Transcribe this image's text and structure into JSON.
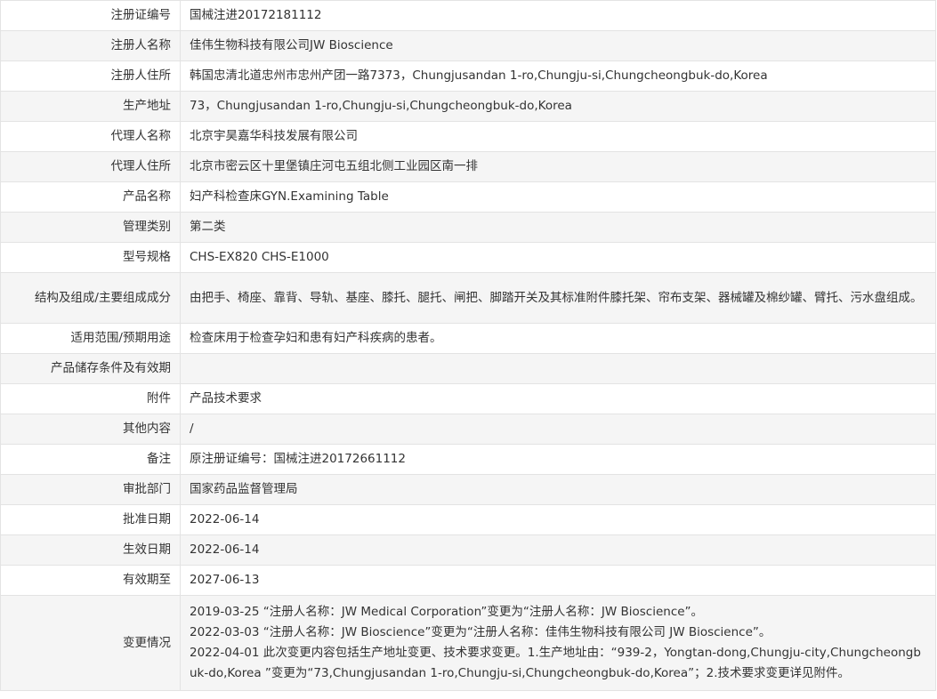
{
  "rows": [
    {
      "label": "注册证编号",
      "value": "国械注进20172181112"
    },
    {
      "label": "注册人名称",
      "value": "佳伟生物科技有限公司JW Bioscience"
    },
    {
      "label": "注册人住所",
      "value": "韩国忠清北道忠州市忠州产团一路7373，Chungjusandan 1-ro,Chungju-si,Chungcheongbuk-do,Korea"
    },
    {
      "label": "生产地址",
      "value": "73，Chungjusandan 1-ro,Chungju-si,Chungcheongbuk-do,Korea"
    },
    {
      "label": "代理人名称",
      "value": "北京宇昊嘉华科技发展有限公司"
    },
    {
      "label": "代理人住所",
      "value": "北京市密云区十里堡镇庄河屯五组北侧工业园区南一排"
    },
    {
      "label": "产品名称",
      "value": "妇产科检查床GYN.Examining Table"
    },
    {
      "label": "管理类别",
      "value": "第二类"
    },
    {
      "label": "型号规格",
      "value": "CHS-EX820 CHS-E1000"
    },
    {
      "label": "结构及组成/主要组成成分",
      "value": "由把手、椅座、靠背、导轨、基座、膝托、腿托、闸把、脚踏开关及其标准附件膝托架、帘布支架、器械罐及棉纱罐、臂托、污水盘组成。"
    },
    {
      "label": "适用范围/预期用途",
      "value": "检查床用于检查孕妇和患有妇产科疾病的患者。"
    },
    {
      "label": "产品储存条件及有效期",
      "value": ""
    },
    {
      "label": "附件",
      "value": "产品技术要求"
    },
    {
      "label": "其他内容",
      "value": "/"
    },
    {
      "label": "备注",
      "value": "原注册证编号：国械注进20172661112"
    },
    {
      "label": "审批部门",
      "value": "国家药品监督管理局"
    },
    {
      "label": "批准日期",
      "value": "2022-06-14"
    },
    {
      "label": "生效日期",
      "value": "2022-06-14"
    },
    {
      "label": "有效期至",
      "value": "2027-06-13"
    }
  ],
  "changes": {
    "label": "变更情况",
    "lines": [
      "2019-03-25 “注册人名称：JW Medical Corporation”变更为“注册人名称：JW Bioscience”。",
      "2022-03-03 “注册人名称：JW Bioscience”变更为“注册人名称：佳伟生物科技有限公司 JW Bioscience”。",
      "2022-04-01 此次变更内容包括生产地址变更、技术要求变更。1.生产地址由：“939-2，Yongtan-dong,Chungju-city,Chungcheongbuk-do,Korea ”变更为“73,Chungjusandan 1-ro,Chungju-si,Chungcheongbuk-do,Korea”；2.技术要求变更详见附件。"
    ]
  }
}
